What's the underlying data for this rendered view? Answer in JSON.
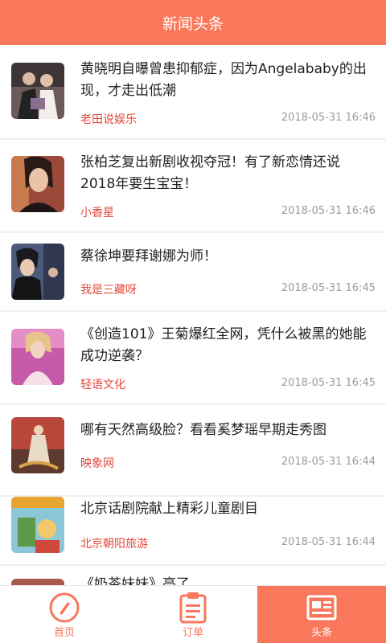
{
  "header": {
    "title": "新闻头条"
  },
  "news": [
    {
      "title": "黄晓明自曝曾患抑郁症，因为Angelababy的出现，才走出低潮",
      "source": "老田说娱乐",
      "time": "2018-05-31 16:46"
    },
    {
      "title": "张柏芝复出新剧收视夺冠！有了新恋情还说2018年要生宝宝！",
      "source": "小香星",
      "time": "2018-05-31 16:46"
    },
    {
      "title": "蔡徐坤要拜谢娜为师！",
      "source": "我是三藏呀",
      "time": "2018-05-31 16:45"
    },
    {
      "title": "《创造101》王菊爆红全网，凭什么被黑的她能成功逆袭？",
      "source": "轻语文化",
      "time": "2018-05-31 16:45"
    },
    {
      "title": "哪有天然高级脸？看看奚梦瑶早期走秀图",
      "source": "映象网",
      "time": "2018-05-31 16:44"
    },
    {
      "title": "北京话剧院献上精彩儿童剧目",
      "source": "北京朝阳旅游",
      "time": "2018-05-31 16:44"
    },
    {
      "title": "《奶茶妹妹》亮了...",
      "source": "",
      "time": ""
    }
  ],
  "tabs": [
    {
      "label": "首页",
      "icon": "compass-icon"
    },
    {
      "label": "订单",
      "icon": "clipboard-icon"
    },
    {
      "label": "头条",
      "icon": "newspaper-icon"
    }
  ],
  "colors": {
    "accent": "#f9775a",
    "source": "#e4473a"
  }
}
